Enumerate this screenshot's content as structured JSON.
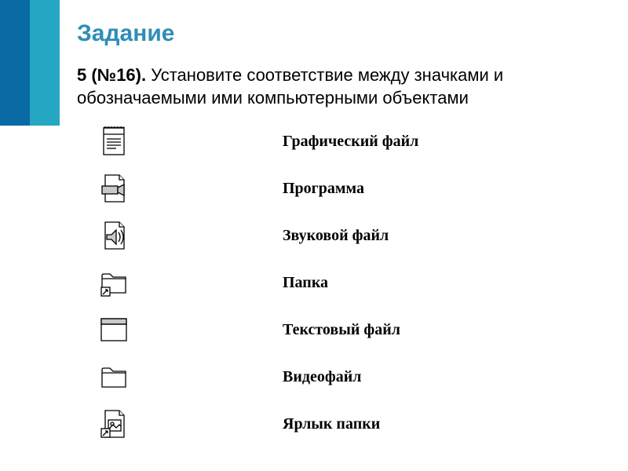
{
  "heading": "Задание",
  "instruction": {
    "lead": "5 (№16).",
    "text": " Установите соответствие между значками и обозначаемыми ими компьютерными объектами"
  },
  "rows": [
    {
      "icon": "text-file-icon",
      "label": "Графический файл"
    },
    {
      "icon": "video-file-icon",
      "label": "Программа"
    },
    {
      "icon": "audio-file-icon",
      "label": "Звуковой файл"
    },
    {
      "icon": "folder-shortcut-icon",
      "label": "Папка"
    },
    {
      "icon": "program-window-icon",
      "label": "Текстовый файл"
    },
    {
      "icon": "folder-icon",
      "label": "Видеофайл"
    },
    {
      "icon": "image-shortcut-icon",
      "label": "Ярлык папки"
    }
  ]
}
